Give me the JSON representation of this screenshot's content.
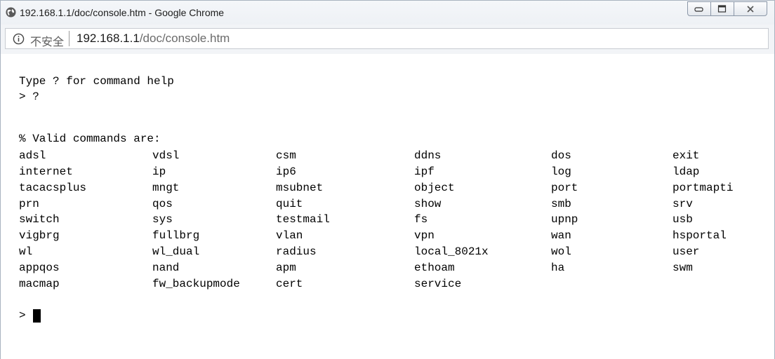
{
  "window": {
    "title": "192.168.1.1/doc/console.htm - Google Chrome"
  },
  "address_bar": {
    "security_label": "不安全",
    "url_host": "192.168.1.1",
    "url_path": "/doc/console.htm"
  },
  "console": {
    "intro": "Type ? for command help",
    "prompt_query": "> ?",
    "valid_header": "% Valid commands are:",
    "commands": [
      [
        "adsl",
        "vdsl",
        "csm",
        "ddns",
        "dos",
        "exit"
      ],
      [
        "internet",
        "ip",
        "ip6",
        "ipf",
        "log",
        "ldap"
      ],
      [
        "tacacsplus",
        "mngt",
        "msubnet",
        "object",
        "port",
        "portmapti"
      ],
      [
        "prn",
        "qos",
        "quit",
        "show",
        "smb",
        "srv"
      ],
      [
        "switch",
        "sys",
        "testmail",
        "fs",
        "upnp",
        "usb"
      ],
      [
        "vigbrg",
        "fullbrg",
        "vlan",
        "vpn",
        "wan",
        "hsportal"
      ],
      [
        "wl",
        "wl_dual",
        "radius",
        "local_8021x",
        "wol",
        "user"
      ],
      [
        "appqos",
        "nand",
        "apm",
        "ethoam",
        "ha",
        "swm"
      ],
      [
        "macmap",
        "fw_backupmode",
        "cert",
        "service",
        "",
        ""
      ]
    ],
    "prompt": ">"
  }
}
